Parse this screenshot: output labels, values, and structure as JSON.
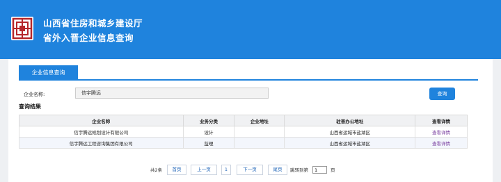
{
  "header": {
    "title_line1": "山西省住房和城乡建设厅",
    "title_line2": "省外入晋企业信息查询"
  },
  "tab": {
    "label": "企业信息查询"
  },
  "search": {
    "label": "企业名称:",
    "value": "信宇腾远",
    "button": "查询"
  },
  "results": {
    "title": "查询结果",
    "columns": [
      "企业名称",
      "业务分类",
      "企业地址",
      "驻晋办公地址",
      "查看详情"
    ],
    "rows": [
      [
        "信宇腾远规划设计有限公司",
        "设计",
        "",
        "山西省运城市盐湖区",
        "查看详情"
      ],
      [
        "信宇腾远工程咨询集团有限公司",
        "监理",
        "",
        "山西省运城市盐湖区",
        "查看详情"
      ]
    ]
  },
  "pager": {
    "total": "共2条",
    "first": "首页",
    "prev": "上一页",
    "page": "1",
    "next": "下一页",
    "last": "尾页",
    "jump_label": "跳转到第",
    "jump_value": "1",
    "page_suffix": "页"
  },
  "colors": {
    "brand_blue": "#1f83dd",
    "detail_link": "#7a3fa0",
    "logo_red": "#b5262a"
  },
  "icons": {
    "logo": "ministry-seal-logo"
  }
}
